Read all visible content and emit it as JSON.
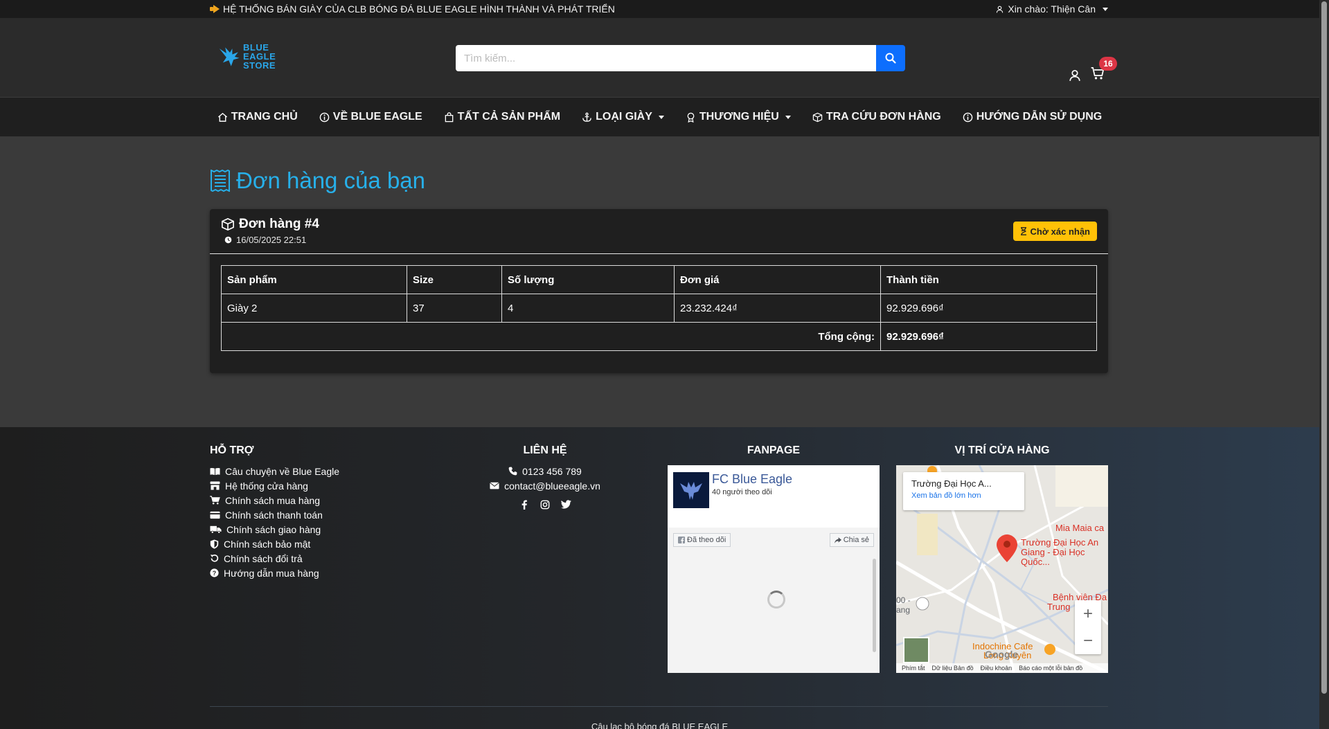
{
  "topbar": {
    "announcement": "HỆ THỐNG BÁN GIÀY CỦA CLB BÓNG ĐÁ BLUE EAGLE HÌNH THÀNH VÀ PHÁT TRIỂN",
    "greeting": "Xin chào: Thiện Cân"
  },
  "header": {
    "logo": [
      "BLUE",
      "EAGLE",
      "STORE"
    ],
    "search_placeholder": "Tìm kiếm...",
    "cart_count": "16"
  },
  "nav": [
    {
      "label": "TRANG CHỦ",
      "icon": "home-icon"
    },
    {
      "label": "VỀ BLUE EAGLE",
      "icon": "info-icon"
    },
    {
      "label": "TẤT CẢ SẢN PHẨM",
      "icon": "bag-icon"
    },
    {
      "label": "LOẠI GIÀY",
      "icon": "anchor-icon",
      "dropdown": true
    },
    {
      "label": "THƯƠNG HIỆU",
      "icon": "award-icon",
      "dropdown": true
    },
    {
      "label": "TRA CỨU ĐƠN HÀNG",
      "icon": "box-icon"
    },
    {
      "label": "HƯỚNG DẪN SỬ DỤNG",
      "icon": "info-icon"
    }
  ],
  "main": {
    "title": "Đơn hàng của bạn",
    "order": {
      "title": "Đơn hàng #4",
      "date": "16/05/2025 22:51",
      "status": "Chờ xác nhận",
      "columns": [
        "Sản phẩm",
        "Size",
        "Số lượng",
        "Đơn giá",
        "Thành tiền"
      ],
      "rows": [
        [
          "Giày 2",
          "37",
          "4",
          "23.232.424₫",
          "92.929.696₫"
        ]
      ],
      "total_label": "Tổng cộng:",
      "total_value": "92.929.696₫"
    }
  },
  "footer": {
    "support": {
      "heading": "HỖ TRỢ",
      "items": [
        "Câu chuyện về Blue Eagle",
        "Hệ thống cửa hàng",
        "Chính sách mua hàng",
        "Chính sách thanh toán",
        "Chính sách giao hàng",
        "Chính sách bảo mật",
        "Chính sách đổi trả",
        "Hướng dẫn mua hàng"
      ]
    },
    "contact": {
      "heading": "LIÊN HỆ",
      "phone": "0123 456 789",
      "email": "contact@blueeagle.vn"
    },
    "fanpage": {
      "heading": "FANPAGE",
      "name": "FC Blue Eagle",
      "followers": "40 người theo dõi",
      "followed_label": "Đã theo dõi",
      "share_label": "Chia sẻ"
    },
    "map": {
      "heading": "VỊ TRÍ CỬA HÀNG",
      "place": "Trường Đại Học A...",
      "bigger_map": "Xem bản đồ lớn hơn",
      "marker_label_1": "Trường Đại Học An",
      "marker_label_2": "Giang - Đại Học Quốc...",
      "poi_1": "Mia Maia ca",
      "poi_2": "Bệnh viện Đa",
      "poi_3": "Trung",
      "poi_4": "Indochine Cafe",
      "poi_5": "Long Xuyên",
      "poi_6": "00 -",
      "poi_7": "ang",
      "google": "Google",
      "footer_items": [
        "Phím tắt",
        "Dữ liệu Bản đồ",
        "Điều khoản",
        "Báo cáo một lỗi bản đồ"
      ]
    },
    "copyright": "Câu lạc bộ bóng đá BLUE EAGLE"
  },
  "colors": {
    "accent": "#27b0ea",
    "search_button": "#0d6efd",
    "status": "#ffc107",
    "badge": "#dc3545"
  }
}
